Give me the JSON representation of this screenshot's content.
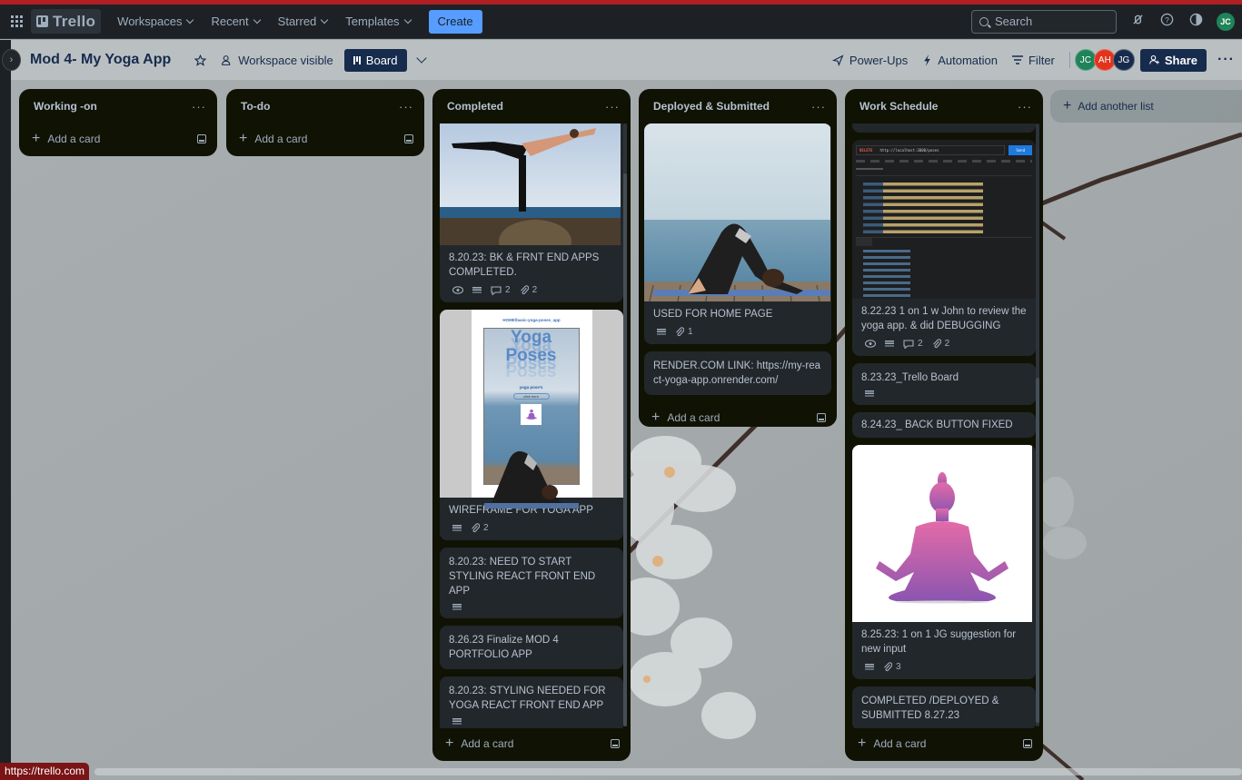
{
  "topnav": {
    "logo_text": "Trello",
    "menus": [
      {
        "label": "Workspaces"
      },
      {
        "label": "Recent"
      },
      {
        "label": "Starred"
      },
      {
        "label": "Templates"
      }
    ],
    "create_label": "Create",
    "search_placeholder": "Search",
    "user_initials": "JC"
  },
  "board": {
    "title": "Mod 4- My Yoga App",
    "visibility_label": "Workspace visible",
    "view_label": "Board",
    "powerups_label": "Power-Ups",
    "automation_label": "Automation",
    "filter_label": "Filter",
    "members": [
      {
        "initials": "JC",
        "color": "#1f845a"
      },
      {
        "initials": "AH",
        "color": "#e2341d"
      },
      {
        "initials": "JG",
        "color": "#172b4d"
      }
    ],
    "share_label": "Share",
    "add_list_label": "Add another list"
  },
  "lists": [
    {
      "title": "Working -on",
      "add_card_label": "Add a card",
      "cards": []
    },
    {
      "title": "To-do",
      "add_card_label": "Add a card",
      "cards": []
    },
    {
      "title": "Completed",
      "add_card_label": "Add a card",
      "cards": [
        {
          "cover": "warrior-pose-photo",
          "title": "8.20.23: BK & FRNT END APPS COMPLETED.",
          "watch": true,
          "description": true,
          "comments": "2",
          "attachments": "2"
        },
        {
          "cover": "wireframe-image",
          "title": "WIREFRAME FOR YOGA APP",
          "description": true,
          "attachments": "2",
          "wireframe_heading": "Yoga Poses",
          "wireframe_url": "HOME/basic-yoga-poses_app",
          "wireframe_sub": "yoga pose's",
          "wireframe_button": "click here"
        },
        {
          "title": "8.20.23: NEED TO START STYLING REACT FRONT END APP",
          "description": true
        },
        {
          "title": "8.26.23 Finalize MOD 4 PORTFOLIO APP"
        },
        {
          "title": "8.20.23: STYLING NEEDED FOR YOGA REACT FRONT END APP",
          "description": true
        }
      ]
    },
    {
      "title": "Deployed & Submitted",
      "add_card_label": "Add a card",
      "cards": [
        {
          "cover": "downward-dog-photo",
          "title": "USED FOR HOME PAGE",
          "description": true,
          "attachments": "1"
        },
        {
          "title": "RENDER.COM LINK: https://my-react-yoga-app.onrender.com/"
        }
      ]
    },
    {
      "title": "Work Schedule",
      "add_card_label": "Add a card",
      "cards": [
        {
          "cover": "postman-screenshot",
          "title": "8.22.23 1 on 1 w John to review the yoga app. & did DEBUGGING",
          "watch": true,
          "description": true,
          "comments": "2",
          "attachments": "2",
          "postman_method": "DELETE",
          "postman_url": "http://localhost:3000/poses",
          "postman_send": "Send"
        },
        {
          "title": "8.23.23_Trello Board",
          "description": true
        },
        {
          "title": "8.24.23_ BACK BUTTON FIXED"
        },
        {
          "cover": "meditation-silhouette",
          "title": "8.25.23: 1 on 1 JG suggestion for new input",
          "description": true,
          "attachments": "3"
        },
        {
          "title": "COMPLETED /DEPLOYED & SUBMITTED 8.27.23"
        }
      ]
    }
  ],
  "status_bar": {
    "url": "https://trello.com"
  }
}
